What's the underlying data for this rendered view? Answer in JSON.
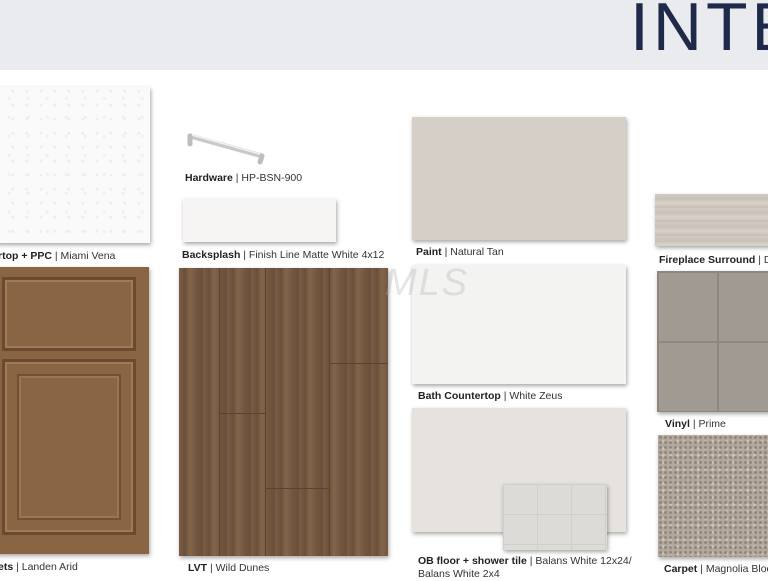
{
  "header": {
    "title": "INTE"
  },
  "watermark": "MLS",
  "colors": {
    "header_bg": "#e9ebee",
    "title_color": "#1f2a4a",
    "paint_natural_tan": "#d6cfc7",
    "cabinet_landen_arid": "#8a6543"
  },
  "items": {
    "countertop": {
      "label": "rtop + PPC",
      "value": " | Miami Vena"
    },
    "hardware": {
      "label": "Hardware",
      "value": " | HP-BSN-900",
      "icon": "drawer-pull-handle"
    },
    "backsplash": {
      "label": "Backsplash",
      "value": " | Finish Line Matte White 4x12"
    },
    "paint": {
      "label": "Paint",
      "value": " | Natural Tan"
    },
    "fireplace": {
      "label": "Fireplace Surround",
      "value": " | Dr"
    },
    "cabinets": {
      "label": "ets",
      "value": " | Landen Arid"
    },
    "lvt": {
      "label": "LVT",
      "value": " | Wild Dunes"
    },
    "bath_countertop": {
      "label": "Bath Countertop",
      "value": " | White Zeus"
    },
    "vinyl": {
      "label": "Vinyl",
      "value": " | Prime"
    },
    "ob_floor": {
      "label": "OB floor + shower tile",
      "value": " | Balans White 12x24/",
      "value_line2": "Balans White 2x4"
    },
    "carpet": {
      "label": "Carpet",
      "value": " | Magnolia Bloo"
    }
  }
}
